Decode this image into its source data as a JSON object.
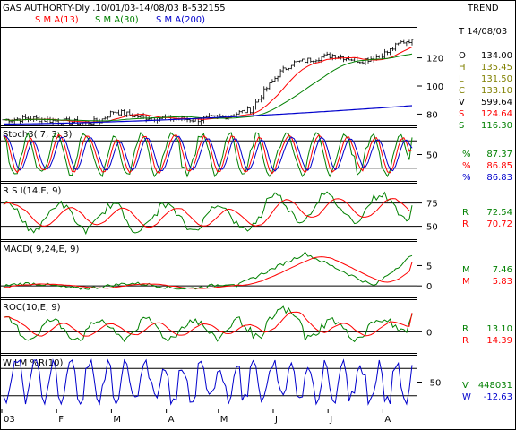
{
  "header": {
    "title": "GAS AUTHORTY-Dly .10/01/03-14/08/03  B-532155",
    "trend_label": "TREND",
    "sma_labels": [
      {
        "text": "S M A(13)",
        "color": "#ff0000"
      },
      {
        "text": "S M A(30)",
        "color": "#008000"
      },
      {
        "text": "S M A(200)",
        "color": "#0000cc"
      }
    ]
  },
  "colors": {
    "price": "#000000",
    "red": "#ff0000",
    "green": "#008000",
    "blue": "#0000cc",
    "purple": "#800080",
    "olive": "#808000",
    "grid": "#000000"
  },
  "info": {
    "date": "T 14/08/03",
    "rows": [
      {
        "k": "O",
        "v": "134.00",
        "color": "#000000"
      },
      {
        "k": "H",
        "v": "135.45",
        "color": "#808000"
      },
      {
        "k": "L",
        "v": "131.50",
        "color": "#808000"
      },
      {
        "k": "C",
        "v": "133.10",
        "color": "#808000"
      },
      {
        "k": "V",
        "v": "599.64",
        "color": "#000000"
      },
      {
        "k": "S",
        "v": "124.64",
        "color": "#ff0000"
      },
      {
        "k": "S",
        "v": "116.30",
        "color": "#008000"
      }
    ]
  },
  "panels": {
    "stoch": {
      "label": "Stoch3( 7, 3, 3)",
      "ticks": [
        "50"
      ],
      "values": [
        {
          "k": "%",
          "v": "87.37",
          "color": "#008000"
        },
        {
          "k": "%",
          "v": "86.85",
          "color": "#ff0000"
        },
        {
          "k": "%",
          "v": "86.83",
          "color": "#0000cc"
        }
      ]
    },
    "rsi": {
      "label": "R S I(14,E, 9)",
      "ticks": [
        "75",
        "50"
      ],
      "values": [
        {
          "k": "R",
          "v": "72.54",
          "color": "#008000"
        },
        {
          "k": "R",
          "v": "70.72",
          "color": "#ff0000"
        }
      ]
    },
    "macd": {
      "label": "MACD( 9,24,E, 9)",
      "ticks": [
        "5",
        "0"
      ],
      "values": [
        {
          "k": "M",
          "v": "7.46",
          "color": "#008000"
        },
        {
          "k": "M",
          "v": "5.83",
          "color": "#ff0000"
        }
      ]
    },
    "roc": {
      "label": "ROC(10,E, 9)",
      "ticks": [
        "0"
      ],
      "values": [
        {
          "k": "R",
          "v": "13.10",
          "color": "#008000"
        },
        {
          "k": "R",
          "v": "14.39",
          "color": "#ff0000"
        }
      ]
    },
    "wlm": {
      "label": "W LM %R(10)",
      "ticks": [
        "-50"
      ],
      "values": [
        {
          "k": "V",
          "v": "448031",
          "color": "#008000"
        },
        {
          "k": "W",
          "v": "-12.63",
          "color": "#0000cc"
        }
      ]
    }
  },
  "chart_data": {
    "type": "line",
    "title": "GAS AUTHORTY-Dly .10/01/03-14/08/03  B-532155",
    "x_tick_labels": [
      "03",
      "F",
      "M",
      "A",
      "M",
      "J",
      "J",
      "A"
    ],
    "price_ticks": [
      "120",
      "100",
      "80"
    ],
    "price_axis": {
      "ylim": [
        72,
        142
      ]
    },
    "sessions": 150,
    "price": {
      "anchor_sessions": [
        0,
        10,
        20,
        30,
        35,
        40,
        50,
        60,
        70,
        80,
        90,
        95,
        100,
        105,
        110,
        120,
        130,
        135,
        140,
        145,
        149
      ],
      "anchor_close": [
        76,
        77,
        75,
        74,
        75,
        82,
        78,
        77,
        76,
        78,
        83,
        96,
        108,
        116,
        118,
        122,
        118,
        120,
        124,
        131,
        133.1
      ],
      "last": {
        "open": 134.0,
        "high": 135.45,
        "low": 131.5,
        "close": 133.1
      }
    },
    "sma13_last": 124.64,
    "sma30_last": 116.3,
    "sma200_range": [
      73,
      86
    ],
    "stoch_last": {
      "k": 87.37,
      "d": 86.85,
      "slow": 86.83
    },
    "rsi_last": {
      "rsi": 72.54,
      "signal": 70.72
    },
    "macd_last": {
      "macd": 7.46,
      "signal": 5.83
    },
    "roc_last": {
      "roc": 13.1,
      "signal": 14.39
    },
    "wlm_last": {
      "percent_r": -12.63,
      "volume": 448031
    }
  }
}
